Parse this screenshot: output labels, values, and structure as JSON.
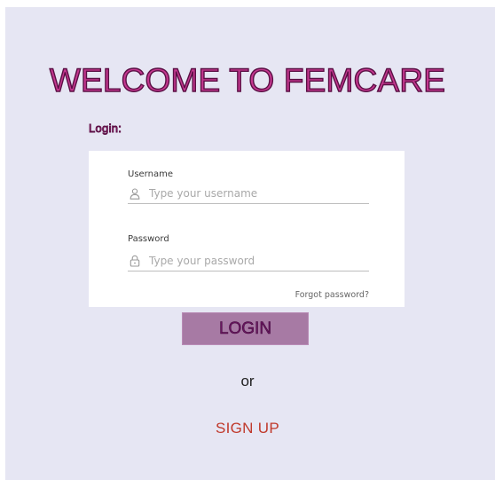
{
  "page": {
    "title": "WELCOME TO FEMCARE"
  },
  "login_form": {
    "caption": "Login:",
    "username": {
      "label": "Username",
      "placeholder": "Type your username",
      "value": "",
      "icon": "user-icon"
    },
    "password": {
      "label": "Password",
      "placeholder": "Type your password",
      "value": "",
      "icon": "lock-icon"
    },
    "forgot_label": "Forgot password?",
    "submit_label": "LOGIN"
  },
  "separator": "or",
  "signup_label": "SIGN UP",
  "colors": {
    "background": "#e6e6f3",
    "title_fill": "#c4378f",
    "title_outline": "#5a0f44",
    "login_button": "#a77aa4",
    "signup_link": "#c0392b"
  }
}
